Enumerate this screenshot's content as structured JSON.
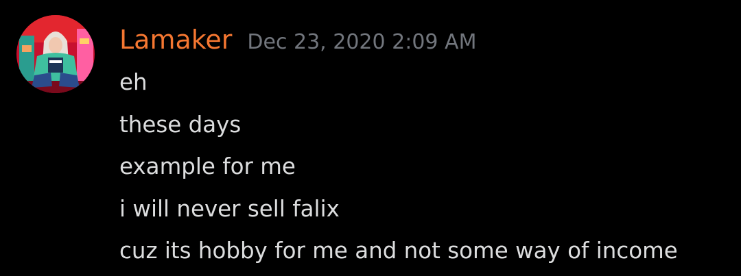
{
  "message_group": {
    "author": {
      "username": "Lamaker",
      "username_color": "#f57731"
    },
    "timestamp": "Dec 23, 2020 2:09 AM",
    "messages": [
      "eh",
      "these days",
      "example for me",
      "i will never sell falix",
      "cuz its hobby for me and not some way of income"
    ]
  }
}
